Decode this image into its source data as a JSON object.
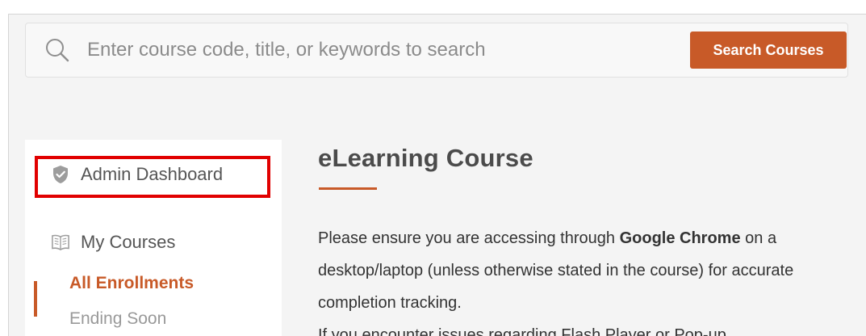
{
  "search": {
    "placeholder": "Enter course code, title, or keywords to search",
    "button_label": "Search Courses",
    "icon": "search-icon"
  },
  "sidebar": {
    "items": [
      {
        "label": "Admin Dashboard",
        "icon": "shield-check-icon"
      },
      {
        "label": "My Courses",
        "icon": "book-icon"
      }
    ],
    "subitems": [
      {
        "label": "All Enrollments",
        "active": true
      },
      {
        "label": "Ending Soon",
        "active": false
      }
    ]
  },
  "main": {
    "title": "eLearning Course",
    "paragraph1": {
      "before": "Please ensure you are accessing through ",
      "strong": "Google Chrome",
      "after": " on a desktop/laptop (unless otherwise stated in the course) for accurate completion tracking."
    },
    "paragraph2": "If you encounter issues regarding Flash Player or Pop-up"
  },
  "colors": {
    "accent": "#c85a28",
    "highlight": "#e10000",
    "background": "#f4f4f4",
    "text": "#333333",
    "muted": "#999999"
  }
}
